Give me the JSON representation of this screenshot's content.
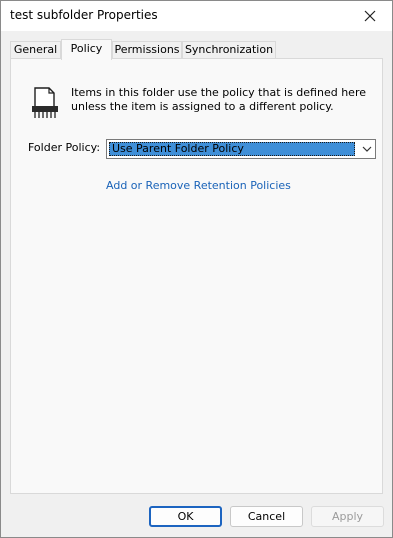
{
  "window": {
    "title": "test subfolder Properties"
  },
  "tabs": [
    {
      "label": "General"
    },
    {
      "label": "Policy"
    },
    {
      "label": "Permissions"
    },
    {
      "label": "Synchronization"
    }
  ],
  "policy": {
    "icon": "policy-document-icon",
    "description": "Items in this folder use the policy that is defined here unless the item is assigned to a different policy.",
    "folder_policy_label": "Folder Policy:",
    "folder_policy_value": "Use Parent Folder Policy",
    "retention_link": "Add or Remove Retention Policies"
  },
  "buttons": {
    "ok": "OK",
    "cancel": "Cancel",
    "apply": "Apply"
  },
  "colors": {
    "link": "#1a63b8",
    "selection": "#3f8fd8",
    "ok_border": "#1c64c0"
  }
}
